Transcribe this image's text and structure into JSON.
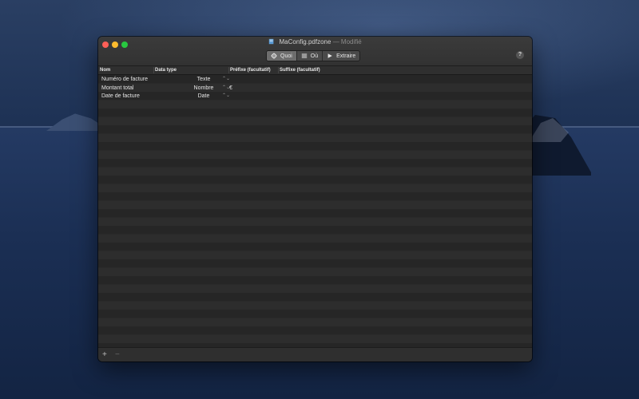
{
  "window": {
    "filename": "MaConfig.pdfzone",
    "separator": "—",
    "status": "Modifié"
  },
  "toolbar": {
    "segments": [
      {
        "label": "Quoi",
        "icon": "gear-icon",
        "selected": true
      },
      {
        "label": "Où",
        "icon": "list-icon",
        "selected": false
      },
      {
        "label": "Extraire",
        "icon": "play-icon",
        "selected": false
      }
    ],
    "help_label": "?"
  },
  "table": {
    "columns": [
      "Nom",
      "Data type",
      "Préfixe (facultatif)",
      "Suffixe (facultatif)"
    ],
    "rows": [
      {
        "name": "Numéro de facture",
        "type": "Texte",
        "prefix": "",
        "suffix": ""
      },
      {
        "name": "Montant total",
        "type": "Nombre",
        "prefix": "€",
        "suffix": ""
      },
      {
        "name": "Date de facture",
        "type": "Date",
        "prefix": "",
        "suffix": ""
      }
    ],
    "stepper_glyph": "⌃⌄"
  },
  "bottom": {
    "add_label": "+",
    "remove_label": "−"
  },
  "colors": {
    "close": "#fe5f57",
    "minimize": "#febc2e",
    "maximize": "#28c840",
    "window_bg": "#2b2b2b"
  }
}
